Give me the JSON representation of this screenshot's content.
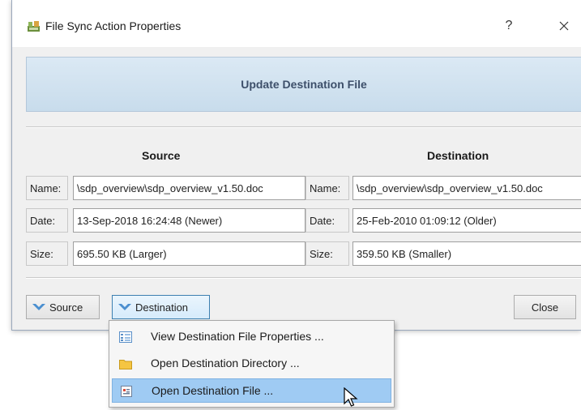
{
  "window": {
    "title": "File Sync Action Properties",
    "help_label": "?",
    "app_icon": "sync-app-icon",
    "close_icon": "close-icon"
  },
  "banner": {
    "title": "Update Destination File"
  },
  "source": {
    "heading": "Source",
    "name_label": "Name:",
    "name_value": "\\sdp_overview\\sdp_overview_v1.50.doc",
    "date_label": "Date:",
    "date_value": "13-Sep-2018 16:24:48 (Newer)",
    "size_label": "Size:",
    "size_value": "695.50 KB (Larger)"
  },
  "destination": {
    "heading": "Destination",
    "name_label": "Name:",
    "name_value": "\\sdp_overview\\sdp_overview_v1.50.doc",
    "date_label": "Date:",
    "date_value": "25-Feb-2010 01:09:12 (Older)",
    "size_label": "Size:",
    "size_value": "359.50 KB (Smaller)"
  },
  "buttons": {
    "source": "Source",
    "destination": "Destination",
    "close": "Close",
    "chevron_icon": "chevron-down-icon"
  },
  "menu": {
    "items": [
      {
        "label": "View Destination File Properties ...",
        "icon": "properties-icon"
      },
      {
        "label": "Open Destination Directory ...",
        "icon": "folder-icon"
      },
      {
        "label": "Open Destination File ...",
        "icon": "document-icon",
        "highlighted": true
      }
    ]
  },
  "colors": {
    "accent": "#3c7fb1",
    "banner_text": "#3d4f6a",
    "menu_highlight": "#9fcbf3",
    "chevron": "#4a8fd0"
  }
}
